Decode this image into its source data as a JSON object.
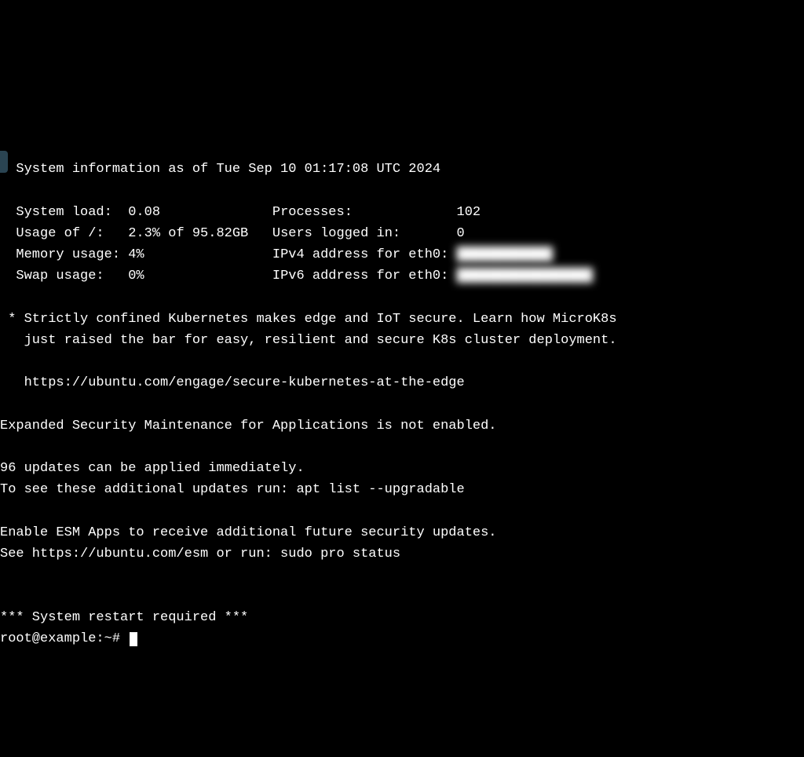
{
  "header": {
    "sysinfo_line": "  System information as of Tue Sep 10 01:17:08 UTC 2024"
  },
  "stats": {
    "system_load_label": "  System load:",
    "system_load_value": "0.08",
    "processes_label": "Processes:",
    "processes_value": "102",
    "usage_label": "  Usage of /:",
    "usage_value": "2.3% of 95.82GB",
    "users_label": "Users logged in:",
    "users_value": "0",
    "memory_label": "  Memory usage:",
    "memory_value": "4%",
    "ipv4_label": "IPv4 address for eth0:",
    "ipv4_value": "████████████",
    "swap_label": "  Swap usage:",
    "swap_value": "0%",
    "ipv6_label": "IPv6 address for eth0:",
    "ipv6_value": "█████████████████"
  },
  "promo": {
    "line1": " * Strictly confined Kubernetes makes edge and IoT secure. Learn how MicroK8s",
    "line2": "   just raised the bar for easy, resilient and secure K8s cluster deployment.",
    "url": "   https://ubuntu.com/engage/secure-kubernetes-at-the-edge"
  },
  "esm": {
    "not_enabled": "Expanded Security Maintenance for Applications is not enabled.",
    "updates_line1": "96 updates can be applied immediately.",
    "updates_line2": "To see these additional updates run: apt list --upgradable",
    "enable_line1": "Enable ESM Apps to receive additional future security updates.",
    "enable_line2": "See https://ubuntu.com/esm or run: sudo pro status"
  },
  "footer": {
    "restart": "*** System restart required ***",
    "prompt": "root@example:~# "
  }
}
